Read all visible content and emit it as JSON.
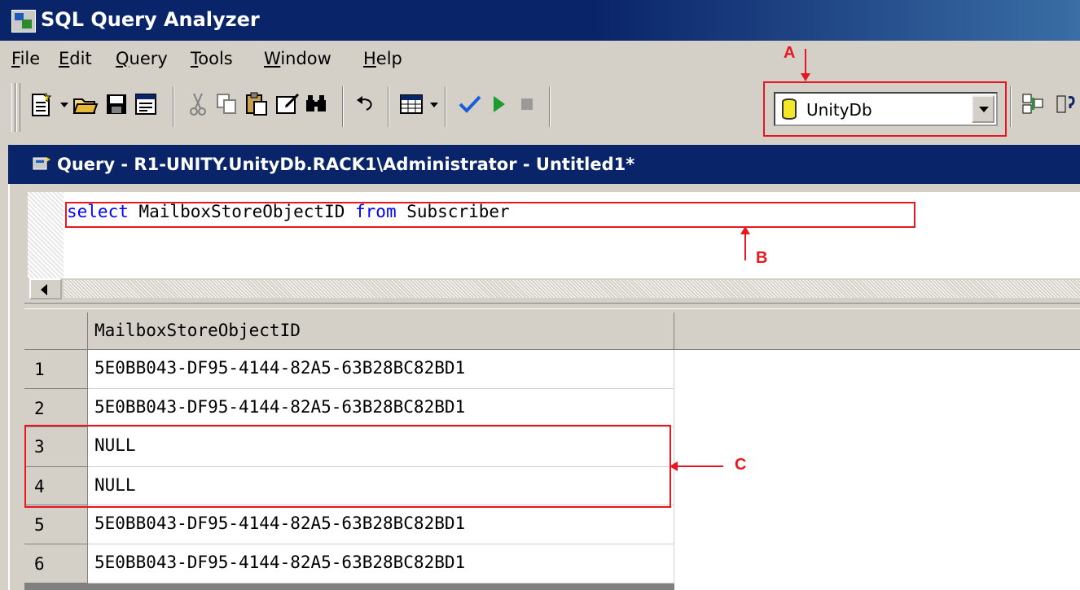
{
  "app": {
    "title": "SQL Query Analyzer"
  },
  "menu": {
    "items": [
      "File",
      "Edit",
      "Query",
      "Tools",
      "Window",
      "Help"
    ]
  },
  "toolbar": {
    "buttons": [
      "new-query-icon",
      "open-icon",
      "save-icon",
      "load-script-icon",
      "cut-icon",
      "copy-icon",
      "paste-icon",
      "clear-window-icon",
      "find-icon",
      "undo-icon",
      "results-grid-icon",
      "parse-icon",
      "execute-icon",
      "stop-icon",
      "object-browser-icon"
    ],
    "database": "UnityDb"
  },
  "query_window": {
    "title": "Query - R1-UNITY.UnityDb.RACK1\\Administrator - Untitled1*",
    "code": {
      "kw1": "select",
      "col": " MailboxStoreObjectID ",
      "kw2": "from",
      "table": " Subscriber"
    }
  },
  "results": {
    "columns": [
      "MailboxStoreObjectID"
    ],
    "rows": [
      {
        "num": "1",
        "value": "5E0BB043-DF95-4144-82A5-63B28BC82BD1"
      },
      {
        "num": "2",
        "value": "5E0BB043-DF95-4144-82A5-63B28BC82BD1"
      },
      {
        "num": "3",
        "value": "NULL"
      },
      {
        "num": "4",
        "value": "NULL"
      },
      {
        "num": "5",
        "value": "5E0BB043-DF95-4144-82A5-63B28BC82BD1"
      },
      {
        "num": "6",
        "value": "5E0BB043-DF95-4144-82A5-63B28BC82BD1"
      }
    ]
  },
  "annotations": {
    "a": "A",
    "b": "B",
    "c": "C"
  },
  "colors": {
    "titlebar": "#0a246a",
    "annotation": "#e8171f",
    "keyword": "#0000ff"
  }
}
